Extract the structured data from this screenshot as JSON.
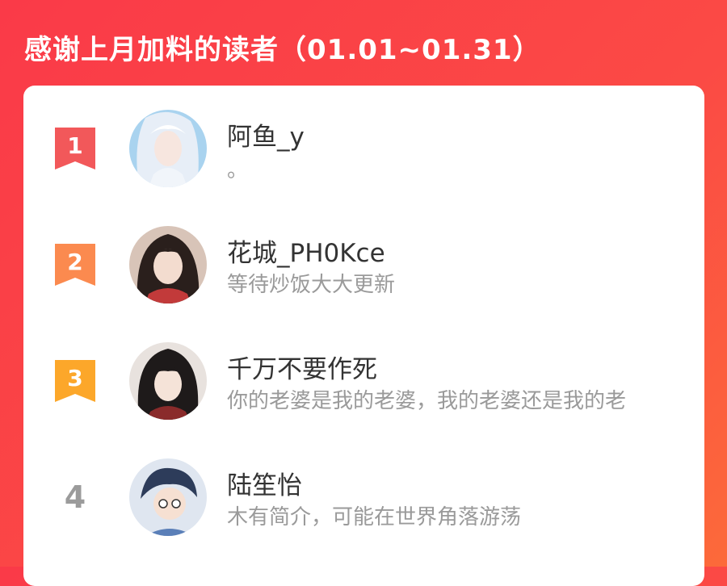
{
  "header": {
    "title": "感谢上月加料的读者（01.01~01.31）"
  },
  "colors": {
    "background": "#fa3a48",
    "rank1": "#f2585a",
    "rank2": "#fb8a4f",
    "rank3": "#fca72a",
    "name": "#333333",
    "desc": "#9a9a9a"
  },
  "readers": [
    {
      "rank": "1",
      "name": "阿鱼_y",
      "desc": "。",
      "avatar": "avatar-icon"
    },
    {
      "rank": "2",
      "name": "花城_PH0Kce",
      "desc": "等待炒饭大大更新",
      "avatar": "avatar-icon"
    },
    {
      "rank": "3",
      "name": "千万不要作死",
      "desc": "你的老婆是我的老婆，我的老婆还是我的老",
      "avatar": "avatar-icon"
    },
    {
      "rank": "4",
      "name": "陆笙怡",
      "desc": "木有简介，可能在世界角落游荡",
      "avatar": "avatar-icon"
    }
  ]
}
